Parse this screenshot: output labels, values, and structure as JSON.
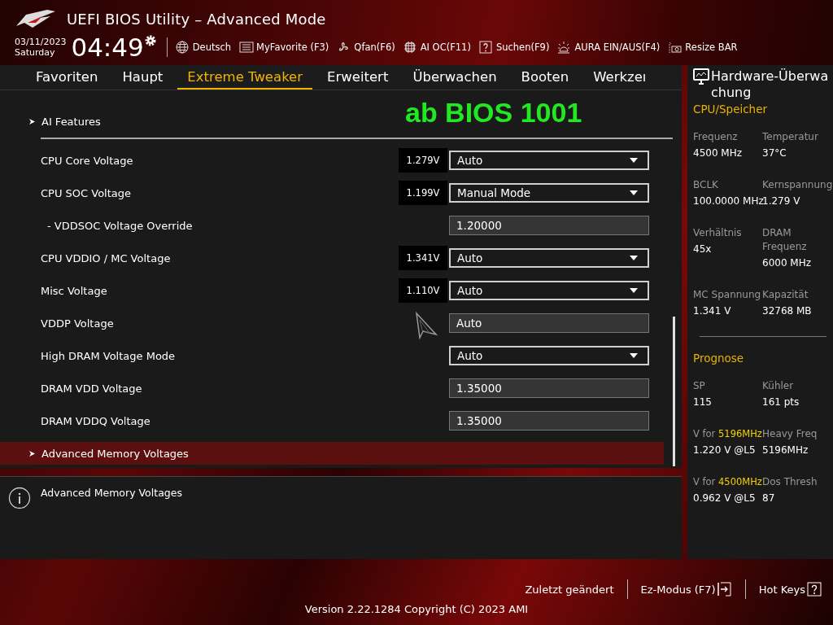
{
  "window": {
    "title": "UEFI BIOS Utility – Advanced Mode"
  },
  "clock": {
    "date": "03/11/2023",
    "day": "Saturday",
    "time": "04:49"
  },
  "toolbar": [
    {
      "label": "Deutsch"
    },
    {
      "label": "MyFavorite (F3)"
    },
    {
      "label": "Qfan(F6)"
    },
    {
      "label": "AI OC(F11)"
    },
    {
      "label": "Suchen(F9)"
    },
    {
      "label": "AURA EIN/AUS(F4)"
    },
    {
      "label": "Resize BAR"
    }
  ],
  "tabs": [
    {
      "label": "Favoriten",
      "selected": false
    },
    {
      "label": "Haupt",
      "selected": false
    },
    {
      "label": "Extreme Tweaker",
      "selected": true
    },
    {
      "label": "Erweitert",
      "selected": false
    },
    {
      "label": "Überwachen",
      "selected": false
    },
    {
      "label": "Booten",
      "selected": false
    },
    {
      "label": "Werkzeı",
      "selected": false
    }
  ],
  "annotation": "ab BIOS 1001",
  "items": [
    {
      "kind": "submenu",
      "label": "AI Features",
      "selected": false
    },
    {
      "kind": "divider"
    },
    {
      "kind": "setting",
      "label": "CPU Core Voltage",
      "reading": "1.279V",
      "control": {
        "kind": "dropdown",
        "value": "Auto"
      },
      "selected": false
    },
    {
      "kind": "setting",
      "label": "CPU SOC Voltage",
      "reading": "1.199V",
      "control": {
        "kind": "dropdown",
        "value": "Manual Mode"
      },
      "selected": false,
      "children": [
        {
          "kind": "setting",
          "label": "- VDDSOC Voltage Override",
          "control": {
            "kind": "field",
            "value": "1.20000"
          },
          "selected": false
        }
      ]
    },
    {
      "kind": "setting",
      "label": "CPU VDDIO / MC Voltage",
      "reading": "1.341V",
      "control": {
        "kind": "dropdown",
        "value": "Auto"
      },
      "selected": false
    },
    {
      "kind": "setting",
      "label": "Misc Voltage",
      "reading": "1.110V",
      "control": {
        "kind": "dropdown",
        "value": "Auto"
      },
      "selected": false
    },
    {
      "kind": "setting",
      "label": "VDDP Voltage",
      "control": {
        "kind": "field",
        "value": "Auto"
      },
      "selected": false
    },
    {
      "kind": "setting",
      "label": "High DRAM Voltage Mode",
      "control": {
        "kind": "dropdown",
        "value": "Auto"
      },
      "selected": false
    },
    {
      "kind": "setting",
      "label": "DRAM VDD Voltage",
      "control": {
        "kind": "field",
        "value": "1.35000"
      },
      "selected": false
    },
    {
      "kind": "setting",
      "label": "DRAM VDDQ Voltage",
      "control": {
        "kind": "field",
        "value": "1.35000"
      },
      "selected": false
    },
    {
      "kind": "submenu",
      "label": "Advanced Memory Voltages",
      "selected": true
    }
  ],
  "help": {
    "text": "Advanced Memory Voltages"
  },
  "monitor": {
    "title": "Hardware-Überwachung",
    "sections": [
      {
        "title": "CPU/Speicher",
        "fields": [
          {
            "label": "Frequenz",
            "value": "4500 MHz"
          },
          {
            "label": "Temperatur",
            "value": "37°C"
          },
          {
            "label": "BCLK",
            "value": "100.0000 MHz"
          },
          {
            "label": "Kernspannung",
            "value": "1.279 V"
          },
          {
            "label": "Verhältnis",
            "value": "45x"
          },
          {
            "label": "DRAM Frequenz",
            "value": "6000 MHz"
          },
          {
            "label": "MC Spannung",
            "value": "1.341 V"
          },
          {
            "label": "Kapazität",
            "value": "32768 MB"
          }
        ]
      },
      {
        "title": "Prognose",
        "fields": [
          {
            "label": "SP",
            "value": "115"
          },
          {
            "label": "Kühler",
            "value": "161 pts"
          },
          {
            "label": "V for",
            "highlight": "5196MHz",
            "value": "1.220 V @L5"
          },
          {
            "label": "Heavy Freq",
            "value": "5196MHz"
          },
          {
            "label": "V for",
            "highlight": "4500MHz",
            "value": "0.962 V @L5"
          },
          {
            "label": "Dos Thresh",
            "value": "87"
          }
        ]
      }
    ]
  },
  "footer": {
    "links": [
      {
        "label": "Zuletzt geändert"
      },
      {
        "label": "Ez-Modus (F7)"
      },
      {
        "label": "Hot Keys"
      }
    ],
    "version": "Version 2.22.1284 Copyright (C) 2023 AMI"
  }
}
